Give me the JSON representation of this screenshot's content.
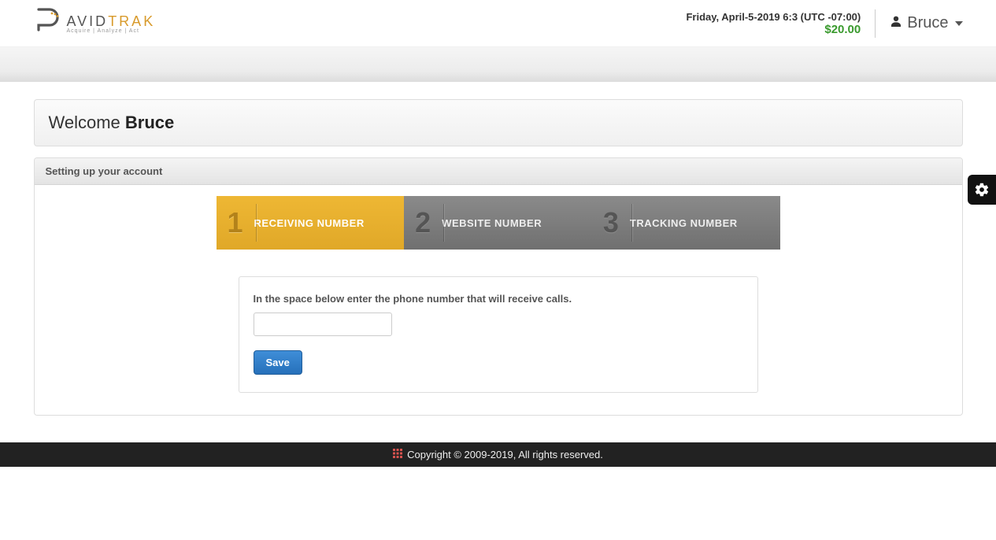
{
  "header": {
    "logo": {
      "brand_first": "AVID",
      "brand_second": "TRAK",
      "tagline": "Acquire  |  Analyze  |  Act"
    },
    "datetime": "Friday, April-5-2019 6:3 (UTC -07:00)",
    "balance": "$20.00",
    "user_name": "Bruce"
  },
  "welcome": {
    "prefix": "Welcome ",
    "name": "Bruce"
  },
  "setup": {
    "panel_title": "Setting up your account",
    "steps": [
      {
        "num": "1",
        "label": "RECEIVING NUMBER",
        "active": true
      },
      {
        "num": "2",
        "label": "WEBSITE NUMBER",
        "active": false
      },
      {
        "num": "3",
        "label": "TRACKING NUMBER",
        "active": false
      }
    ],
    "form": {
      "instruction": "In the space below enter the phone number that will receive calls.",
      "phone_value": "",
      "save_label": "Save"
    }
  },
  "footer": {
    "copyright": "Copyright © 2009-2019, All rights reserved."
  }
}
